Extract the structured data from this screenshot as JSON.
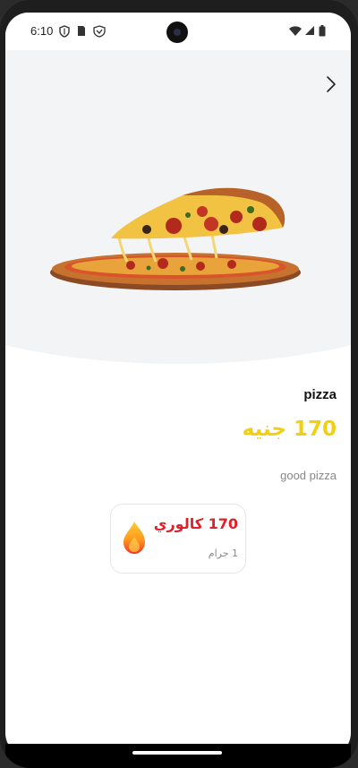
{
  "status_bar": {
    "time": "6:10",
    "icons": [
      "shield-icon",
      "sim-card-icon",
      "vpn-icon",
      "wifi-icon",
      "signal-icon",
      "battery-icon"
    ]
  },
  "header": {
    "back_icon": "chevron-right-icon"
  },
  "product": {
    "image": "pizza-slice-image",
    "name": "pizza",
    "price": "170 جنيه",
    "description": "good pizza"
  },
  "nutrition": {
    "icon": "flame-icon",
    "calories": "170 كالوري",
    "weight": "1 جرام"
  },
  "colors": {
    "price": "#f2cf12",
    "calories": "#e0202a",
    "hero_bg": "#f3f4f6"
  }
}
